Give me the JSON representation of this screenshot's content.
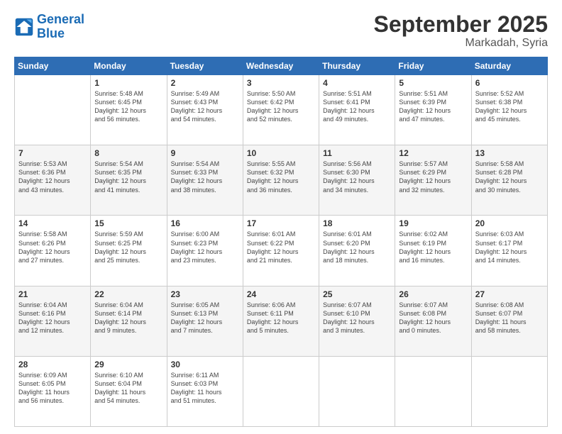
{
  "header": {
    "logo_line1": "General",
    "logo_line2": "Blue",
    "month": "September 2025",
    "location": "Markadah, Syria"
  },
  "weekdays": [
    "Sunday",
    "Monday",
    "Tuesday",
    "Wednesday",
    "Thursday",
    "Friday",
    "Saturday"
  ],
  "weeks": [
    [
      {
        "day": "",
        "info": ""
      },
      {
        "day": "1",
        "info": "Sunrise: 5:48 AM\nSunset: 6:45 PM\nDaylight: 12 hours\nand 56 minutes."
      },
      {
        "day": "2",
        "info": "Sunrise: 5:49 AM\nSunset: 6:43 PM\nDaylight: 12 hours\nand 54 minutes."
      },
      {
        "day": "3",
        "info": "Sunrise: 5:50 AM\nSunset: 6:42 PM\nDaylight: 12 hours\nand 52 minutes."
      },
      {
        "day": "4",
        "info": "Sunrise: 5:51 AM\nSunset: 6:41 PM\nDaylight: 12 hours\nand 49 minutes."
      },
      {
        "day": "5",
        "info": "Sunrise: 5:51 AM\nSunset: 6:39 PM\nDaylight: 12 hours\nand 47 minutes."
      },
      {
        "day": "6",
        "info": "Sunrise: 5:52 AM\nSunset: 6:38 PM\nDaylight: 12 hours\nand 45 minutes."
      }
    ],
    [
      {
        "day": "7",
        "info": "Sunrise: 5:53 AM\nSunset: 6:36 PM\nDaylight: 12 hours\nand 43 minutes."
      },
      {
        "day": "8",
        "info": "Sunrise: 5:54 AM\nSunset: 6:35 PM\nDaylight: 12 hours\nand 41 minutes."
      },
      {
        "day": "9",
        "info": "Sunrise: 5:54 AM\nSunset: 6:33 PM\nDaylight: 12 hours\nand 38 minutes."
      },
      {
        "day": "10",
        "info": "Sunrise: 5:55 AM\nSunset: 6:32 PM\nDaylight: 12 hours\nand 36 minutes."
      },
      {
        "day": "11",
        "info": "Sunrise: 5:56 AM\nSunset: 6:30 PM\nDaylight: 12 hours\nand 34 minutes."
      },
      {
        "day": "12",
        "info": "Sunrise: 5:57 AM\nSunset: 6:29 PM\nDaylight: 12 hours\nand 32 minutes."
      },
      {
        "day": "13",
        "info": "Sunrise: 5:58 AM\nSunset: 6:28 PM\nDaylight: 12 hours\nand 30 minutes."
      }
    ],
    [
      {
        "day": "14",
        "info": "Sunrise: 5:58 AM\nSunset: 6:26 PM\nDaylight: 12 hours\nand 27 minutes."
      },
      {
        "day": "15",
        "info": "Sunrise: 5:59 AM\nSunset: 6:25 PM\nDaylight: 12 hours\nand 25 minutes."
      },
      {
        "day": "16",
        "info": "Sunrise: 6:00 AM\nSunset: 6:23 PM\nDaylight: 12 hours\nand 23 minutes."
      },
      {
        "day": "17",
        "info": "Sunrise: 6:01 AM\nSunset: 6:22 PM\nDaylight: 12 hours\nand 21 minutes."
      },
      {
        "day": "18",
        "info": "Sunrise: 6:01 AM\nSunset: 6:20 PM\nDaylight: 12 hours\nand 18 minutes."
      },
      {
        "day": "19",
        "info": "Sunrise: 6:02 AM\nSunset: 6:19 PM\nDaylight: 12 hours\nand 16 minutes."
      },
      {
        "day": "20",
        "info": "Sunrise: 6:03 AM\nSunset: 6:17 PM\nDaylight: 12 hours\nand 14 minutes."
      }
    ],
    [
      {
        "day": "21",
        "info": "Sunrise: 6:04 AM\nSunset: 6:16 PM\nDaylight: 12 hours\nand 12 minutes."
      },
      {
        "day": "22",
        "info": "Sunrise: 6:04 AM\nSunset: 6:14 PM\nDaylight: 12 hours\nand 9 minutes."
      },
      {
        "day": "23",
        "info": "Sunrise: 6:05 AM\nSunset: 6:13 PM\nDaylight: 12 hours\nand 7 minutes."
      },
      {
        "day": "24",
        "info": "Sunrise: 6:06 AM\nSunset: 6:11 PM\nDaylight: 12 hours\nand 5 minutes."
      },
      {
        "day": "25",
        "info": "Sunrise: 6:07 AM\nSunset: 6:10 PM\nDaylight: 12 hours\nand 3 minutes."
      },
      {
        "day": "26",
        "info": "Sunrise: 6:07 AM\nSunset: 6:08 PM\nDaylight: 12 hours\nand 0 minutes."
      },
      {
        "day": "27",
        "info": "Sunrise: 6:08 AM\nSunset: 6:07 PM\nDaylight: 11 hours\nand 58 minutes."
      }
    ],
    [
      {
        "day": "28",
        "info": "Sunrise: 6:09 AM\nSunset: 6:05 PM\nDaylight: 11 hours\nand 56 minutes."
      },
      {
        "day": "29",
        "info": "Sunrise: 6:10 AM\nSunset: 6:04 PM\nDaylight: 11 hours\nand 54 minutes."
      },
      {
        "day": "30",
        "info": "Sunrise: 6:11 AM\nSunset: 6:03 PM\nDaylight: 11 hours\nand 51 minutes."
      },
      {
        "day": "",
        "info": ""
      },
      {
        "day": "",
        "info": ""
      },
      {
        "day": "",
        "info": ""
      },
      {
        "day": "",
        "info": ""
      }
    ]
  ]
}
